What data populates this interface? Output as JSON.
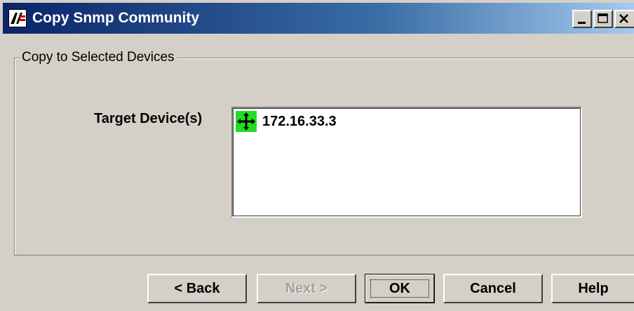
{
  "window": {
    "title": "Copy Snmp Community",
    "controls": {
      "minimize_icon": "minimize-icon",
      "maximize_icon": "maximize-icon",
      "close_icon": "close-icon"
    }
  },
  "group": {
    "legend": "Copy to Selected Devices"
  },
  "target": {
    "label": "Target Device(s)",
    "devices": [
      {
        "address": "172.16.33.3",
        "icon": "device-move-icon",
        "icon_color": "#22dd22"
      }
    ]
  },
  "buttons": {
    "back": "< Back",
    "next": "Next >",
    "ok": "OK",
    "cancel": "Cancel",
    "help": "Help"
  },
  "colors": {
    "titlebar_start": "#0a246a",
    "titlebar_end": "#a6caf0",
    "face": "#d4d0c8"
  }
}
